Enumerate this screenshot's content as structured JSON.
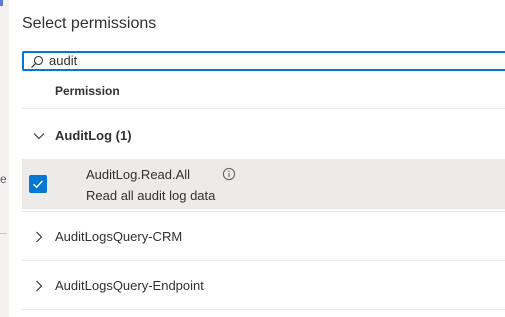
{
  "title": "Select permissions",
  "search": {
    "value": "audit",
    "placeholder": ""
  },
  "table": {
    "column_header": "Permission"
  },
  "group": {
    "label": "AuditLog (1)",
    "expanded": true,
    "permissions": [
      {
        "name": "AuditLog.Read.All",
        "description": "Read all audit log data",
        "checked": true
      }
    ]
  },
  "collapsed_items": [
    {
      "label": "AuditLogsQuery-CRM"
    },
    {
      "label": "AuditLogsQuery-Endpoint"
    }
  ],
  "left_partial": {
    "glyph": "e"
  },
  "colors": {
    "accent": "#0078d4",
    "selected_row": "#edebe9",
    "text": "#323130",
    "divider": "#edebe9"
  }
}
